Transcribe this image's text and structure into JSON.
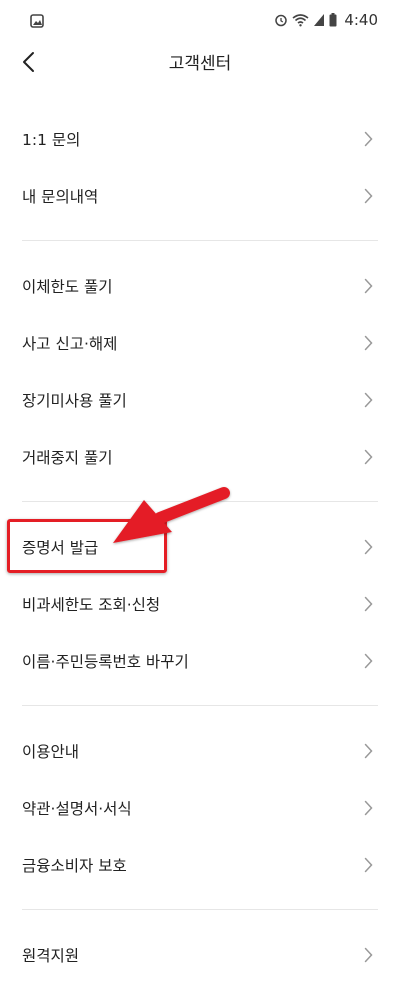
{
  "status_bar": {
    "time": "4:40",
    "icons": [
      "gallery-icon",
      "alarm-icon",
      "wifi-icon",
      "signal-icon",
      "battery-icon"
    ]
  },
  "header": {
    "title": "고객센터",
    "back_icon": "back-chevron-icon"
  },
  "groups": [
    {
      "items": [
        {
          "label": "1:1 문의"
        },
        {
          "label": "내 문의내역"
        }
      ]
    },
    {
      "items": [
        {
          "label": "이체한도 풀기"
        },
        {
          "label": "사고 신고·해제"
        },
        {
          "label": "장기미사용 풀기"
        },
        {
          "label": "거래중지 풀기"
        }
      ]
    },
    {
      "items": [
        {
          "label": "증명서 발급"
        },
        {
          "label": "비과세한도 조회·신청"
        },
        {
          "label": "이름·주민등록번호 바꾸기"
        }
      ]
    },
    {
      "items": [
        {
          "label": "이용안내"
        },
        {
          "label": "약관·설명서·서식"
        },
        {
          "label": "금융소비자 보호"
        }
      ]
    },
    {
      "items": [
        {
          "label": "원격지원"
        }
      ]
    }
  ],
  "annotation": {
    "highlight_color": "#e41e25"
  }
}
